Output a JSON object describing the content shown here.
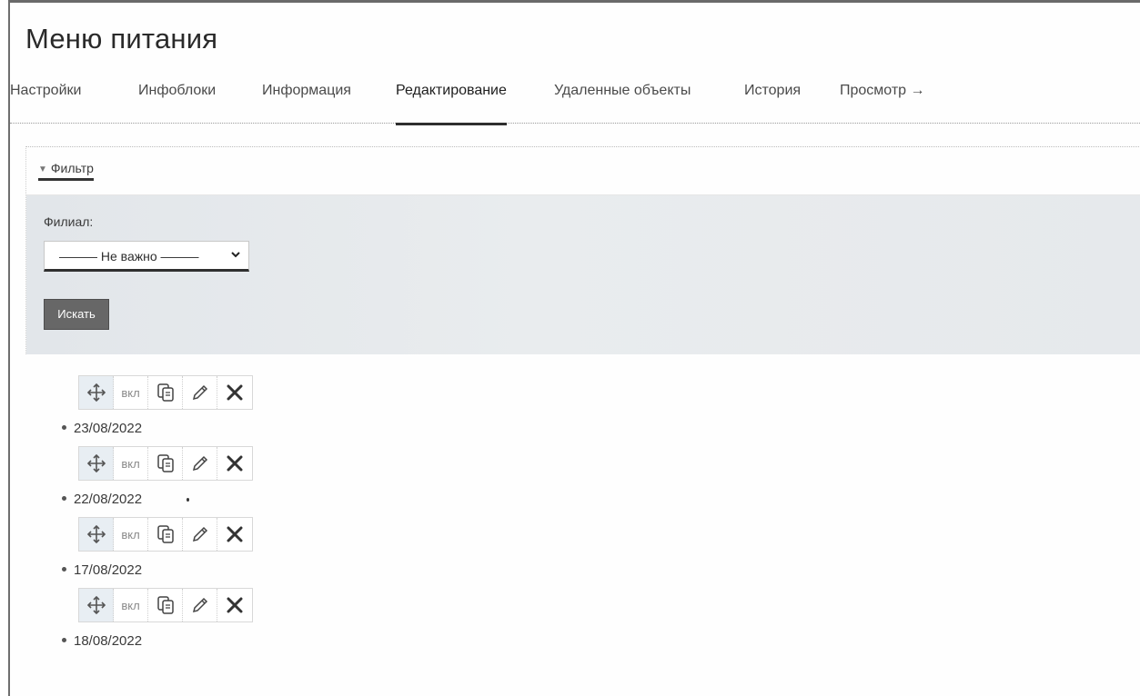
{
  "page": {
    "title": "Меню питания"
  },
  "tabs": [
    {
      "label": "Настройки",
      "active": false
    },
    {
      "label": "Инфоблоки",
      "active": false
    },
    {
      "label": "Информация",
      "active": false
    },
    {
      "label": "Редактирование",
      "active": true
    },
    {
      "label": "Удаленные объекты",
      "active": false
    },
    {
      "label": "История",
      "active": false
    },
    {
      "label": "Просмотр →",
      "active": false
    }
  ],
  "filter": {
    "toggle_label": "Фильтр",
    "branch_label": "Филиал:",
    "branch_value": "——— Не важно ———",
    "search_label": "Искать"
  },
  "item_actions": {
    "toggle_label": "вкл",
    "icons": [
      "move-icon",
      "copy-icon",
      "edit-icon",
      "delete-icon"
    ]
  },
  "items": [
    {
      "date": "23/08/2022"
    },
    {
      "date": "22/08/2022"
    },
    {
      "date": "17/08/2022"
    },
    {
      "date": "18/08/2022"
    }
  ],
  "colors": {
    "search_button_bg": "#676767",
    "filter_body_bg": "#e6e9ec",
    "active_tab_underline": "#2e2e2e"
  }
}
